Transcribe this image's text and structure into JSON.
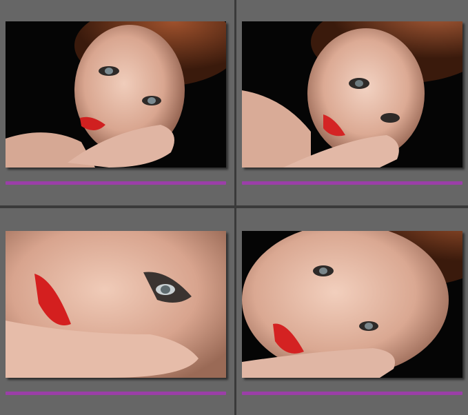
{
  "grid": {
    "cells": [
      {
        "label_color": "#9b3fa8",
        "selected": false
      },
      {
        "label_color": "#9b3fa8",
        "selected": false
      },
      {
        "label_color": "#9b3fa8",
        "selected": false
      },
      {
        "label_color": "#9b3fa8",
        "selected": false
      }
    ]
  },
  "colors": {
    "cell_background": "#666666",
    "divider": "#3a3a3a",
    "photo_background": "#050505",
    "label_purple": "#9b3fa8"
  }
}
